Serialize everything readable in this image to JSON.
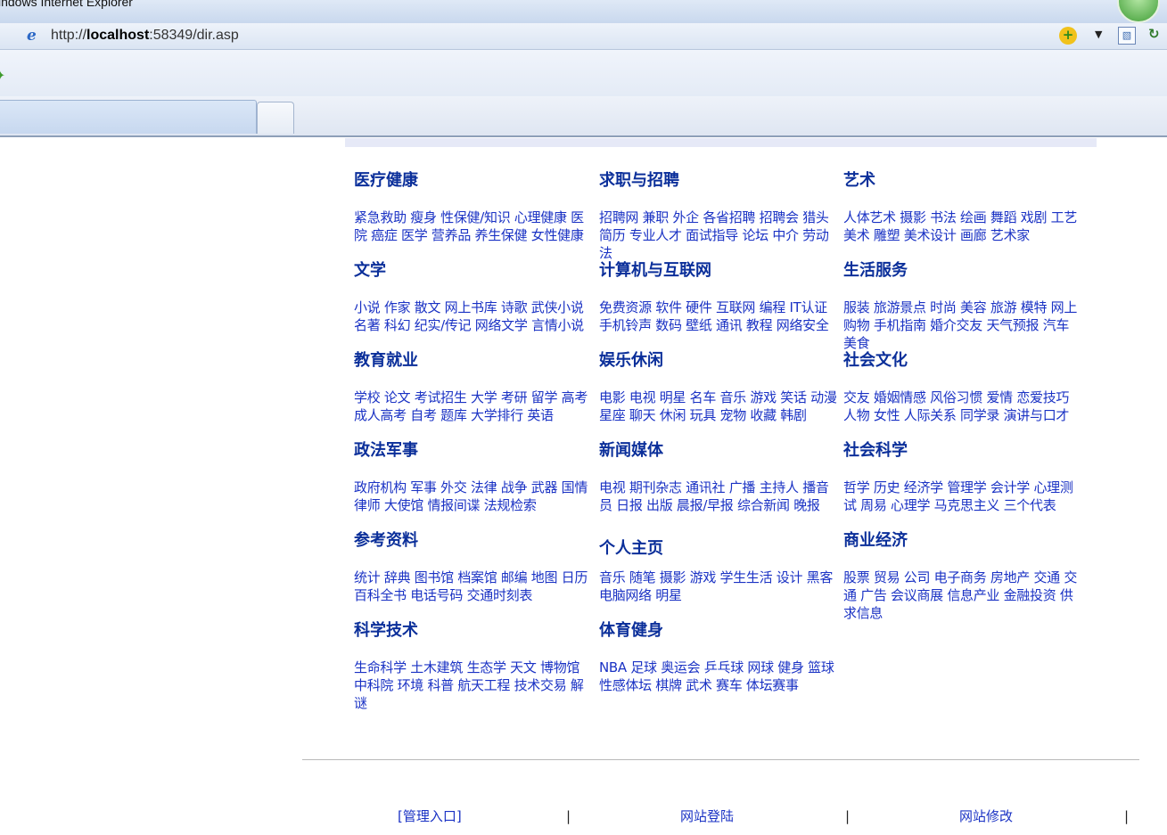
{
  "browser": {
    "window_title": "indows Internet Explorer",
    "url_prefix": "http://",
    "url_host": "localhost",
    "url_rest": ":58349/dir.asp"
  },
  "categories": [
    {
      "title": "医疗健康",
      "links": [
        "紧急救助",
        "瘦身",
        "性保健/知识",
        "心理健康",
        "医院",
        "癌症",
        "医学",
        "营养品",
        "养生保健",
        "女性健康"
      ]
    },
    {
      "title": "求职与招聘",
      "links": [
        "招聘网",
        "兼职",
        "外企",
        "各省招聘",
        "招聘会",
        "猎头",
        "简历",
        "专业人才",
        "面试指导",
        "论坛",
        "中介",
        "劳动法"
      ]
    },
    {
      "title": "艺术",
      "links": [
        "人体艺术",
        "摄影",
        "书法",
        "绘画",
        "舞蹈",
        "戏剧",
        "工艺美术",
        "雕塑",
        "美术设计",
        "画廊",
        "艺术家"
      ]
    },
    {
      "title": "文学",
      "links": [
        "小说",
        "作家",
        "散文",
        "网上书库",
        "诗歌",
        "武侠小说",
        "名著",
        "科幻",
        "纪实/传记",
        "网络文学",
        "言情小说"
      ]
    },
    {
      "title": "计算机与互联网",
      "links": [
        "免费资源",
        "软件",
        "硬件",
        "互联网",
        "编程",
        "IT认证",
        "手机铃声",
        "数码",
        "壁纸",
        "通讯",
        "教程",
        "网络安全"
      ]
    },
    {
      "title": "生活服务",
      "links": [
        "服装",
        "旅游景点",
        "时尚",
        "美容",
        "旅游",
        "模特",
        "网上购物",
        "手机指南",
        "婚介交友",
        "天气预报",
        "汽车",
        "美食"
      ]
    },
    {
      "title": "教育就业",
      "links": [
        "学校",
        "论文",
        "考试招生",
        "大学",
        "考研",
        "留学",
        "高考",
        "成人高考",
        "自考",
        "题库",
        "大学排行",
        "英语"
      ]
    },
    {
      "title": "娱乐休闲",
      "links": [
        "电影",
        "电视",
        "明星",
        "名车",
        "音乐",
        "游戏",
        "笑话",
        "动漫",
        "星座",
        "聊天",
        "休闲",
        "玩具",
        "宠物",
        "收藏",
        "韩剧"
      ]
    },
    {
      "title": "社会文化",
      "links": [
        "交友",
        "婚姻情感",
        "风俗习惯",
        "爱情",
        "恋爱技巧",
        "人物",
        "女性",
        "人际关系",
        "同学录",
        "演讲与口才"
      ]
    },
    {
      "title": "政法军事",
      "links": [
        "政府机构",
        "军事",
        "外交",
        "法律",
        "战争",
        "武器",
        "国情",
        "律师",
        "大使馆",
        "情报间谍",
        "法规检索"
      ]
    },
    {
      "title": "新闻媒体",
      "links": [
        "电视",
        "期刊杂志",
        "通讯社",
        "广播",
        "主持人",
        "播音员",
        "日报",
        "出版",
        "晨报/早报",
        "综合新闻",
        "晚报"
      ]
    },
    {
      "title": "社会科学",
      "links": [
        "哲学",
        "历史",
        "经济学",
        "管理学",
        "会计学",
        "心理测试",
        "周易",
        "心理学",
        "马克思主义",
        "三个代表"
      ]
    },
    {
      "title": "参考资料",
      "links": [
        "统计",
        "辞典",
        "图书馆",
        "档案馆",
        "邮编",
        "地图",
        "日历",
        "百科全书",
        "电话号码",
        "交通时刻表"
      ]
    },
    {
      "title": "个人主页",
      "links": [
        "音乐",
        "随笔",
        "摄影",
        "游戏",
        "学生生活",
        "设计",
        "黑客",
        "电脑网络",
        "明星"
      ]
    },
    {
      "title": "商业经济",
      "links": [
        "股票",
        "贸易",
        "公司",
        "电子商务",
        "房地产",
        "交通",
        "交通",
        "广告",
        "会议商展",
        "信息产业",
        "金融投资",
        "供求信息"
      ]
    },
    {
      "title": "科学技术",
      "links": [
        "生命科学",
        "土木建筑",
        "生态学",
        "天文",
        "博物馆",
        "中科院",
        "环境",
        "科普",
        "航天工程",
        "技术交易",
        "解谜"
      ]
    },
    {
      "title": "体育健身",
      "links": [
        "NBA",
        "足球",
        "奥运会",
        "乒乓球",
        "网球",
        "健身",
        "篮球",
        "性感体坛",
        "棋牌",
        "武术",
        "赛车",
        "体坛赛事"
      ]
    }
  ],
  "footer": {
    "admin_label": "[管理入口]",
    "login_label": "网站登陆",
    "edit_label": "网站修改",
    "separator": "|"
  }
}
